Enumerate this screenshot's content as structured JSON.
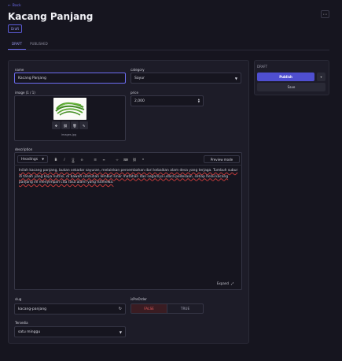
{
  "header": {
    "back_label": "Back",
    "title": "Kacang Panjang",
    "status_badge": "Draft"
  },
  "tabs": [
    {
      "label": "DRAFT",
      "active": true
    },
    {
      "label": "PUBLISHED",
      "active": false
    }
  ],
  "form": {
    "name_label": "name",
    "name_value": "Kacang Panjang",
    "category_label": "category",
    "category_value": "Sayur",
    "image_label": "image (1 / 1)",
    "image_filename": "images.jpg",
    "price_label": "price",
    "price_value": "2,000",
    "description_label": "description",
    "headings_label": "Headings",
    "preview_label": "Preview mode",
    "description_text": "Inilah kacang panjang, bukan sekadar sayuran, melainkan persembahan dari kebaikan alam desa yang terjaga. Tumbuh subur di tanah yang kaya nutrisi, di bawah sentuhan lembut sinar matahari dan segarnya udara pedesaan, setiap helai kacang panjang ini menyimpan cita rasa alami yang istimewa.",
    "expand_label": "Expand",
    "slug_label": "slug",
    "slug_value": "kacang-panjang",
    "isPreOrder_label": "isPreOrder",
    "false_label": "FALSE",
    "true_label": "TRUE",
    "isPreOrder_value": false,
    "tersedia_label": "Tersedia",
    "tersedia_value": "satu minggu"
  },
  "sidebar": {
    "state_label": "DRAFT",
    "publish_label": "Publish",
    "save_label": "Save"
  },
  "colors": {
    "accent": "#5b5bd6",
    "background": "#16151f",
    "card": "#1d1c28",
    "false_active": "#e05a5a"
  }
}
